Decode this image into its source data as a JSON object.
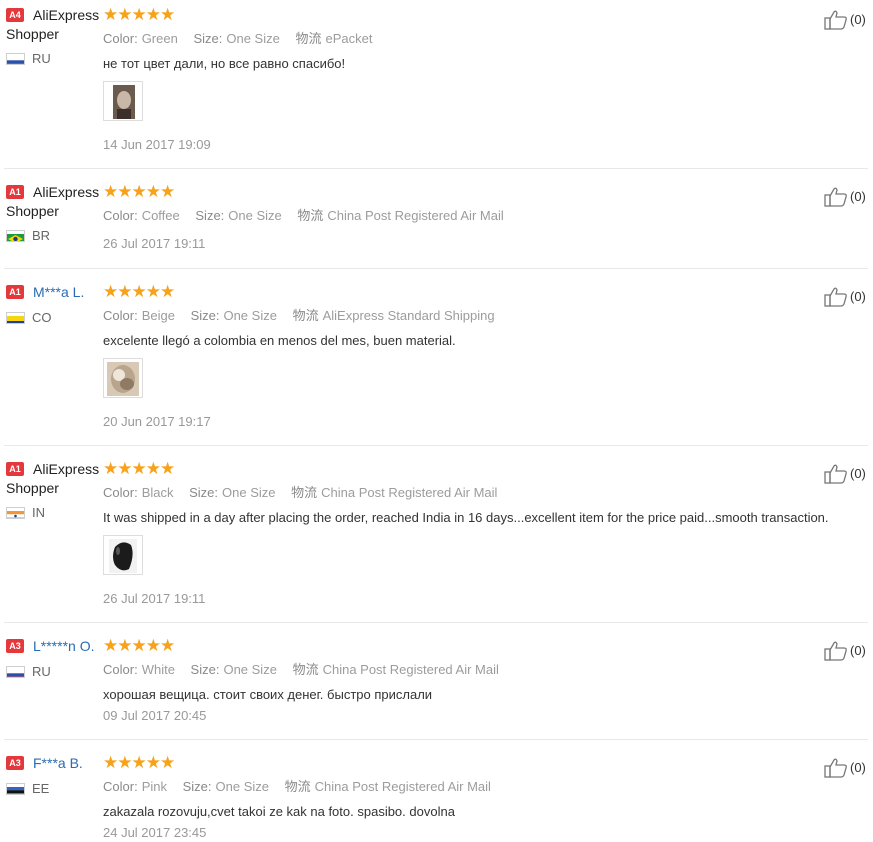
{
  "labels": {
    "color": "Color:",
    "size": "Size:",
    "shipping": "物流"
  },
  "reviews": [
    {
      "badge": "A4",
      "name": "AliExpress",
      "name2": "Shopper",
      "name_link": false,
      "country": "RU",
      "flag": "ru",
      "rating": 5,
      "color": "Green",
      "size": "One Size",
      "shipping": "ePacket",
      "text": "не тот цвет дали, но все равно спасибо!",
      "photo": "photo-doll",
      "date": "14 Jun 2017 19:09",
      "helpful": "(0)"
    },
    {
      "badge": "A1",
      "name": "AliExpress",
      "name2": "Shopper",
      "name_link": false,
      "country": "BR",
      "flag": "br",
      "rating": 5,
      "color": "Coffee",
      "size": "One Size",
      "shipping": "China Post Registered Air Mail",
      "text": "",
      "photo": "",
      "date": "26 Jul 2017 19:11",
      "helpful": "(0)"
    },
    {
      "badge": "A1",
      "name": "M***a L.",
      "name2": "",
      "name_link": true,
      "country": "CO",
      "flag": "co",
      "rating": 5,
      "color": "Beige",
      "size": "One Size",
      "shipping": "AliExpress Standard Shipping",
      "text": "excelente llegó a colombia en menos del mes, buen material.",
      "photo": "photo-fur",
      "date": "20 Jun 2017 19:17",
      "helpful": "(0)"
    },
    {
      "badge": "A1",
      "name": "AliExpress",
      "name2": "Shopper",
      "name_link": false,
      "country": "IN",
      "flag": "in",
      "rating": 5,
      "color": "Black",
      "size": "One Size",
      "shipping": "China Post Registered Air Mail",
      "text": "It was shipped in a day after placing the order, reached India in 16 days...excellent item for the price paid...smooth transaction.",
      "photo": "photo-black",
      "date": "26 Jul 2017 19:11",
      "helpful": "(0)"
    },
    {
      "badge": "A3",
      "name": "L*****n O.",
      "name2": "",
      "name_link": true,
      "country": "RU",
      "flag": "ru",
      "rating": 5,
      "color": "White",
      "size": "One Size",
      "shipping": "China Post Registered Air Mail",
      "text": "хорошая вещица. стоит своих денег. быстро прислали",
      "photo": "",
      "date": "09 Jul 2017 20:45",
      "helpful": "(0)"
    },
    {
      "badge": "A3",
      "name": "F***a B.",
      "name2": "",
      "name_link": true,
      "country": "EE",
      "flag": "ee",
      "rating": 5,
      "color": "Pink",
      "size": "One Size",
      "shipping": "China Post Registered Air Mail",
      "text": "zakazala rozovuju,cvet takoi ze kak na foto. spasibo. dovolna",
      "photo": "",
      "date": "24 Jul 2017 23:45",
      "helpful": "(0)"
    }
  ]
}
